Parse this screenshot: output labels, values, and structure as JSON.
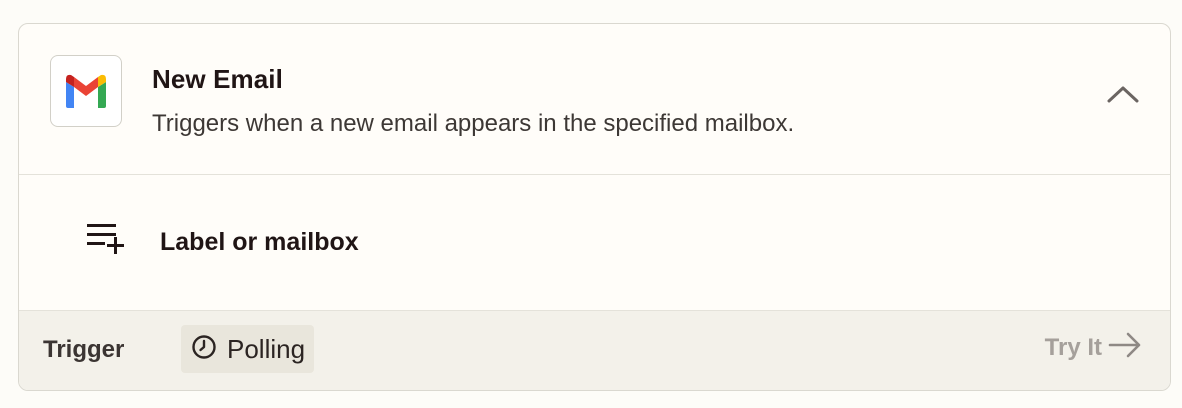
{
  "trigger_card": {
    "app_icon": "gmail-icon",
    "title": "New Email",
    "description": "Triggers when a new email appears in the specified mailbox.",
    "collapse_icon": "chevron-up-icon"
  },
  "field": {
    "icon": "add-list-icon",
    "label": "Label or mailbox"
  },
  "footer": {
    "type_label": "Trigger",
    "mode_icon": "clock-icon",
    "mode_label": "Polling",
    "try_label": "Try It",
    "try_icon": "arrow-right-icon"
  },
  "colors": {
    "gmail_red": "#EA4335",
    "gmail_blue": "#4285F4",
    "gmail_green": "#34A853",
    "gmail_yellow": "#FBBC04",
    "gmail_dark_red": "#C5221F",
    "footer_bg": "#f3f1ea"
  }
}
